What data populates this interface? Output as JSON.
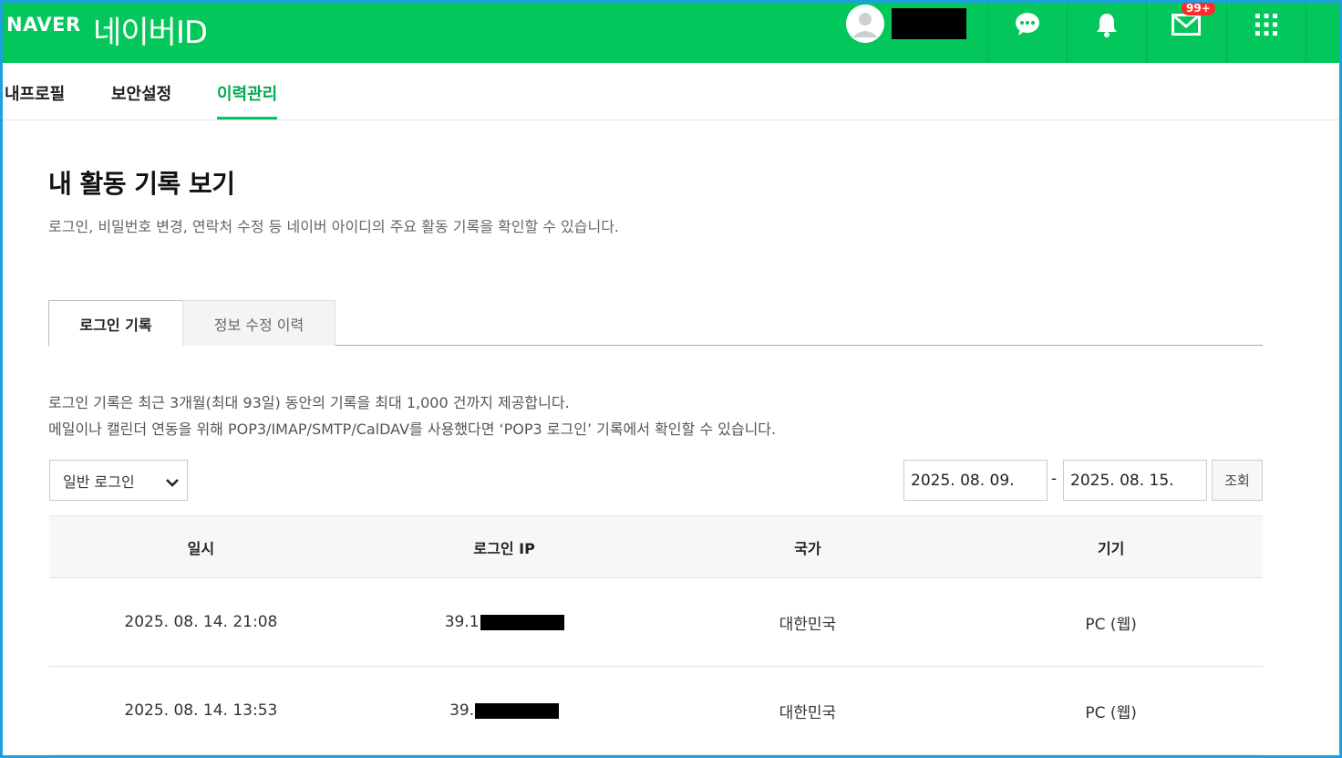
{
  "header": {
    "brand": "NAVER",
    "title": "네이버ID",
    "mail_badge": "99+",
    "colors": {
      "brand_green": "#03c75a",
      "badge_red": "#ff2b2b"
    },
    "icons": [
      "avatar-icon",
      "chat-icon",
      "bell-icon",
      "mail-icon",
      "apps-grid-icon"
    ]
  },
  "nav": {
    "items": [
      {
        "label": "내프로필"
      },
      {
        "label": "보안설정"
      },
      {
        "label": "이력관리",
        "active": true
      }
    ]
  },
  "main": {
    "title": "내 활동 기록 보기",
    "description": "로그인, 비밀번호 변경, 연락처 수정 등 네이버 아이디의 주요 활동 기록을 확인할 수 있습니다.",
    "tabs": [
      {
        "label": "로그인 기록",
        "active": true
      },
      {
        "label": "정보 수정 이력"
      }
    ],
    "notice1": "로그인 기록은 최근 3개월(최대 93일) 동안의 기록을 최대 1,000 건까지 제공합니다.",
    "notice2": "메일이나 캘린더 연동을 위해 POP3/IMAP/SMTP/CalDAV를 사용했다면 ‘POP3 로그인’ 기록에서 확인할 수 있습니다.",
    "filter": {
      "select_value": "일반 로그인",
      "date_from": "2025. 08. 09.",
      "date_separator": "-",
      "date_to": "2025. 08. 15.",
      "search_label": "조회"
    },
    "table": {
      "headers": [
        "일시",
        "로그인 IP",
        "국가",
        "기기"
      ],
      "rows": [
        {
          "datetime": "2025. 08. 14. 21:08",
          "ip_prefix": "39.1",
          "country": "대한민국",
          "device": "PC (웹)"
        },
        {
          "datetime": "2025. 08. 14. 13:53",
          "ip_prefix": "39.",
          "country": "대한민국",
          "device": "PC (웹)"
        }
      ]
    }
  }
}
